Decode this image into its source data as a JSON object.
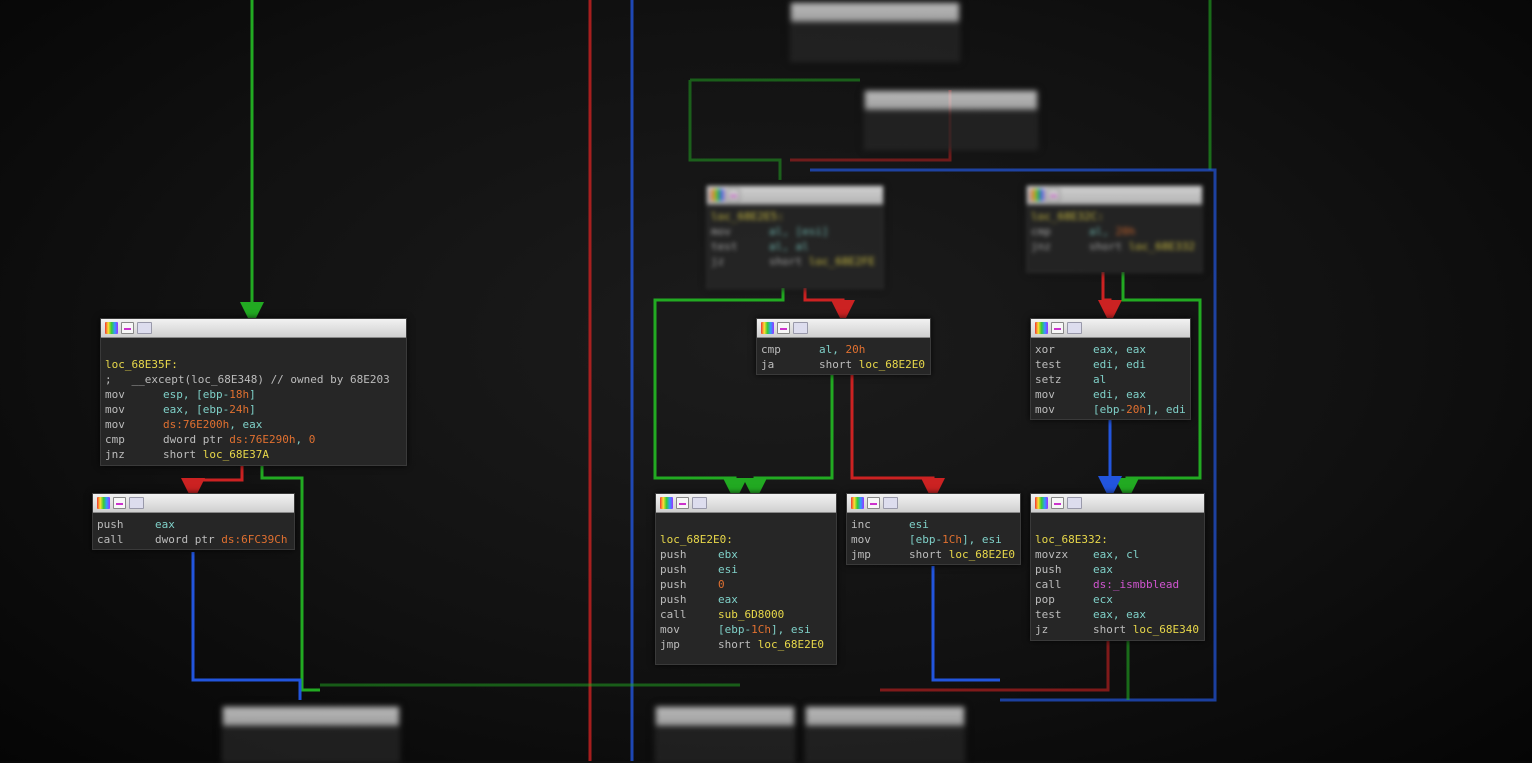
{
  "colors": {
    "background": "#111111",
    "edge_true": "#22aa22",
    "edge_false": "#cc2222",
    "edge_uncond": "#2255dd",
    "label": "#e8d84a",
    "register": "#7fd0c8",
    "immediate": "#e07030",
    "api": "#d055d0"
  },
  "header_icons": [
    "color-palette-icon",
    "graph-overview-icon",
    "zoom-icon"
  ],
  "nodes": {
    "n1": {
      "lines": [
        {
          "text": ""
        },
        {
          "label": "loc_68E35F:"
        },
        {
          "comment": ";   __except(loc_68E348) // owned by 68E203"
        },
        {
          "mnemonic": "mov",
          "operands": "esp, [ebp-18h]"
        },
        {
          "mnemonic": "mov",
          "operands": "eax, [ebp-24h]"
        },
        {
          "mnemonic": "mov",
          "operands": "ds:76E200h, eax"
        },
        {
          "mnemonic": "cmp",
          "operands": "dword ptr ds:76E290h, 0"
        },
        {
          "mnemonic": "jnz",
          "operands": "short loc_68E37A"
        }
      ]
    },
    "n2": {
      "lines": [
        {
          "mnemonic": "push",
          "operands": "eax"
        },
        {
          "mnemonic": "call",
          "operands": "dword ptr ds:6FC39Ch"
        }
      ]
    },
    "n3": {
      "lines": [
        {
          "label": "loc_68E2E5:"
        },
        {
          "mnemonic": "mov",
          "operands": "al, [esi]"
        },
        {
          "mnemonic": "test",
          "operands": "al, al"
        },
        {
          "mnemonic": "jz",
          "operands": "short loc_68E2FE"
        }
      ]
    },
    "n4": {
      "lines": [
        {
          "label": "loc_68E32C:"
        },
        {
          "mnemonic": "cmp",
          "operands": "al, 20h"
        },
        {
          "mnemonic": "jnz",
          "operands": "short loc_68E332"
        }
      ]
    },
    "n5": {
      "lines": [
        {
          "mnemonic": "cmp",
          "operands": "al, 20h"
        },
        {
          "mnemonic": "ja",
          "operands": "short loc_68E2E0"
        }
      ]
    },
    "n6": {
      "lines": [
        {
          "mnemonic": "xor",
          "operands": "eax, eax"
        },
        {
          "mnemonic": "test",
          "operands": "edi, edi"
        },
        {
          "mnemonic": "setz",
          "operands": "al"
        },
        {
          "mnemonic": "mov",
          "operands": "edi, eax"
        },
        {
          "mnemonic": "mov",
          "operands": "[ebp-20h], edi"
        }
      ]
    },
    "n7": {
      "lines": [
        {
          "text": ""
        },
        {
          "label": "loc_68E2E0:"
        },
        {
          "mnemonic": "push",
          "operands": "ebx"
        },
        {
          "mnemonic": "push",
          "operands": "esi"
        },
        {
          "mnemonic": "push",
          "operands": "0"
        },
        {
          "mnemonic": "push",
          "operands": "eax"
        },
        {
          "mnemonic": "call",
          "operands": "sub_6D8000"
        },
        {
          "mnemonic": "mov",
          "operands": "[ebp-1Ch], esi"
        },
        {
          "mnemonic": "jmp",
          "operands": "short loc_68E2E0"
        }
      ]
    },
    "n8": {
      "lines": [
        {
          "mnemonic": "inc",
          "operands": "esi"
        },
        {
          "mnemonic": "mov",
          "operands": "[ebp-1Ch], esi"
        },
        {
          "mnemonic": "jmp",
          "operands": "short loc_68E2E0"
        }
      ]
    },
    "n9": {
      "lines": [
        {
          "text": ""
        },
        {
          "label": "loc_68E332:"
        },
        {
          "mnemonic": "movzx",
          "operands": "eax, cl"
        },
        {
          "mnemonic": "push",
          "operands": "eax"
        },
        {
          "mnemonic": "call",
          "operands": "ds:_ismbblead"
        },
        {
          "mnemonic": "pop",
          "operands": "ecx"
        },
        {
          "mnemonic": "test",
          "operands": "eax, eax"
        },
        {
          "mnemonic": "jz",
          "operands": "short loc_68E340"
        }
      ]
    }
  }
}
